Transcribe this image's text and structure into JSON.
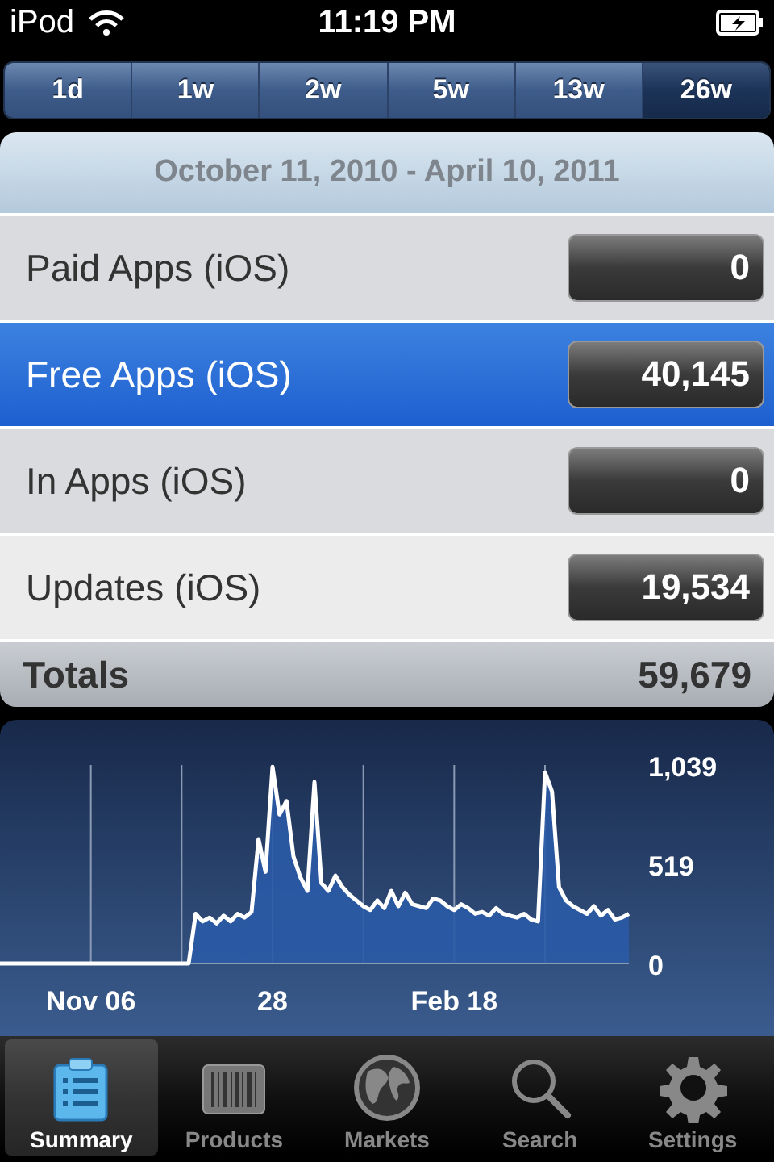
{
  "status_bar": {
    "carrier": "iPod",
    "time": "11:19 PM"
  },
  "periods": [
    {
      "label": "1d",
      "selected": false
    },
    {
      "label": "1w",
      "selected": false
    },
    {
      "label": "2w",
      "selected": false
    },
    {
      "label": "5w",
      "selected": false
    },
    {
      "label": "13w",
      "selected": false
    },
    {
      "label": "26w",
      "selected": true
    }
  ],
  "date_range": "October 11, 2010 - April 10, 2011",
  "rows": [
    {
      "label": "Paid Apps (iOS)",
      "value": "0",
      "selected": false
    },
    {
      "label": "Free Apps (iOS)",
      "value": "40,145",
      "selected": true
    },
    {
      "label": "In Apps (iOS)",
      "value": "0",
      "selected": false
    },
    {
      "label": "Updates (iOS)",
      "value": "19,534",
      "selected": false
    }
  ],
  "totals": {
    "label": "Totals",
    "value": "59,679"
  },
  "chart": {
    "chart_data": {
      "type": "area",
      "grid": true,
      "categories": [
        null,
        null,
        null,
        null,
        null,
        null,
        null,
        null,
        null,
        null,
        null,
        null,
        null,
        "Nov 06",
        null,
        null,
        null,
        null,
        null,
        null,
        null,
        null,
        null,
        null,
        null,
        null,
        null,
        null,
        null,
        null,
        null,
        null,
        null,
        null,
        null,
        null,
        null,
        null,
        null,
        "28",
        null,
        null,
        null,
        null,
        null,
        null,
        null,
        null,
        null,
        null,
        null,
        null,
        null,
        null,
        null,
        null,
        null,
        null,
        null,
        null,
        null,
        null,
        null,
        null,
        null,
        "Feb 18",
        null,
        null,
        null,
        null,
        null,
        null,
        null,
        null,
        null,
        null,
        null,
        null,
        null,
        null,
        null,
        null,
        null,
        null,
        null,
        null,
        null,
        null,
        null,
        null,
        null
      ],
      "ylim": [
        0,
        1039
      ],
      "yticks": [
        0,
        {
          "value": 519,
          "label": "519"
        },
        {
          "value": 1039,
          "label": "1,039"
        }
      ],
      "series": [
        {
          "color": "#ffffff",
          "values": [
            0,
            0,
            0,
            0,
            0,
            0,
            0,
            0,
            0,
            0,
            0,
            0,
            0,
            0,
            0,
            0,
            0,
            0,
            0,
            0,
            0,
            0,
            0,
            0,
            0,
            0,
            0,
            0,
            260,
            220,
            240,
            210,
            250,
            220,
            260,
            240,
            270,
            650,
            480,
            1030,
            780,
            850,
            560,
            450,
            380,
            950,
            420,
            380,
            460,
            400,
            360,
            330,
            300,
            280,
            330,
            290,
            380,
            300,
            370,
            310,
            300,
            290,
            340,
            330,
            300,
            280,
            310,
            290,
            260,
            270,
            250,
            290,
            260,
            250,
            240,
            260,
            230,
            220,
            1000,
            900,
            400,
            330,
            300,
            280,
            260,
            300,
            250,
            280,
            230,
            240,
            260
          ]
        }
      ]
    }
  },
  "tab_bar": [
    {
      "label": "Summary",
      "selected": true
    },
    {
      "label": "Products",
      "selected": false
    },
    {
      "label": "Markets",
      "selected": false
    },
    {
      "label": "Search",
      "selected": false
    },
    {
      "label": "Settings",
      "selected": false
    }
  ]
}
